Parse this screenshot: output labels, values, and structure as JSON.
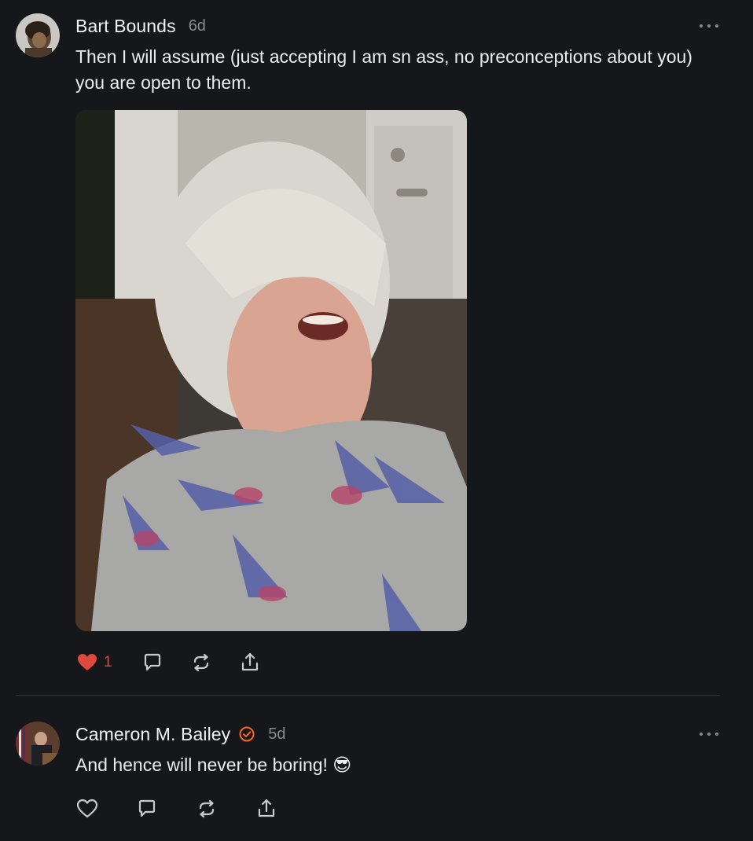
{
  "posts": [
    {
      "author": "Bart Bounds",
      "time": "6d",
      "text": "Then I will assume (just accepting I am sn ass, no preconceptions about you) you are open to them.",
      "likes": "1",
      "liked": true,
      "has_image": true
    },
    {
      "author": "Cameron M. Bailey",
      "verified": true,
      "time": "5d",
      "text": "And hence will never be boring! 😎",
      "likes": "",
      "liked": false,
      "has_image": false
    }
  ],
  "icons": {
    "like": "heart-icon",
    "reply": "comment-bubble-icon",
    "restack": "restack-icon",
    "share": "share-icon",
    "more": "more-options-icon",
    "verified": "verified-badge-icon"
  },
  "colors": {
    "background": "#16171a",
    "like_active": "#e0473e",
    "verified": "#ff6719",
    "muted": "#8a8b90"
  }
}
